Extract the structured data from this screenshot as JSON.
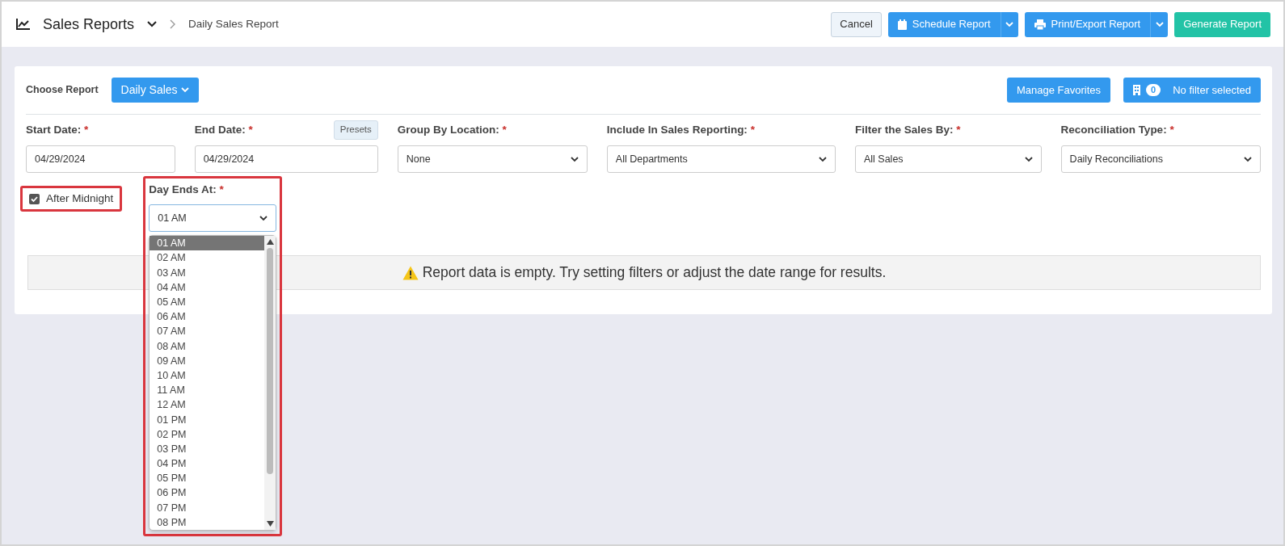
{
  "header": {
    "title": "Sales Reports",
    "breadcrumb": "Daily Sales Report",
    "buttons": [
      {
        "label": "Cancel",
        "kind": "plain"
      },
      {
        "label": "Schedule Report",
        "kind": "split"
      },
      {
        "label": "Print/Export Report",
        "kind": "split"
      },
      {
        "label": "Generate Report",
        "kind": "success"
      }
    ]
  },
  "report_chooser": {
    "label": "Choose Report",
    "value": "Daily Sales"
  },
  "manage_favorites": "Manage Favorites",
  "location_filter": {
    "count": "0",
    "label": "No filter selected"
  },
  "fields": [
    {
      "kind": "date",
      "label": "Start Date:",
      "required_mark": "*",
      "value": "04/29/2024"
    },
    {
      "kind": "date",
      "label": "End Date:",
      "required_mark": "*",
      "value": "04/29/2024",
      "presets": "Presets"
    },
    {
      "kind": "select",
      "label": "Group By Location:",
      "required_mark": "*",
      "value": "None"
    },
    {
      "kind": "select",
      "label": "Include In Sales Reporting:",
      "required_mark": "*",
      "value": "All Departments"
    },
    {
      "kind": "select",
      "label": "Filter the Sales By:",
      "required_mark": "*",
      "value": "All Sales"
    },
    {
      "kind": "select",
      "label": "Reconciliation Type:",
      "required_mark": "*",
      "value": "Daily Reconciliations"
    }
  ],
  "after_midnight": {
    "label": "After Midnight",
    "checked": true,
    "highlighted": true
  },
  "day_ends": {
    "label": "Day Ends At:",
    "required_mark": "*",
    "value": "01 AM",
    "highlighted": true,
    "expanded": true,
    "options": [
      {
        "label": "01 AM",
        "selected": true
      },
      {
        "label": "02 AM",
        "selected": false
      },
      {
        "label": "03 AM",
        "selected": false
      },
      {
        "label": "04 AM",
        "selected": false
      },
      {
        "label": "05 AM",
        "selected": false
      },
      {
        "label": "06 AM",
        "selected": false
      },
      {
        "label": "07 AM",
        "selected": false
      },
      {
        "label": "08 AM",
        "selected": false
      },
      {
        "label": "09 AM",
        "selected": false
      },
      {
        "label": "10 AM",
        "selected": false
      },
      {
        "label": "11 AM",
        "selected": false
      },
      {
        "label": "12 AM",
        "selected": false
      },
      {
        "label": "01 PM",
        "selected": false
      },
      {
        "label": "02 PM",
        "selected": false
      },
      {
        "label": "03 PM",
        "selected": false
      },
      {
        "label": "04 PM",
        "selected": false
      },
      {
        "label": "05 PM",
        "selected": false
      },
      {
        "label": "06 PM",
        "selected": false
      },
      {
        "label": "07 PM",
        "selected": false
      },
      {
        "label": "08 PM",
        "selected": false
      }
    ]
  },
  "empty_message": "Report data is empty. Try setting filters or adjust the date range for results."
}
